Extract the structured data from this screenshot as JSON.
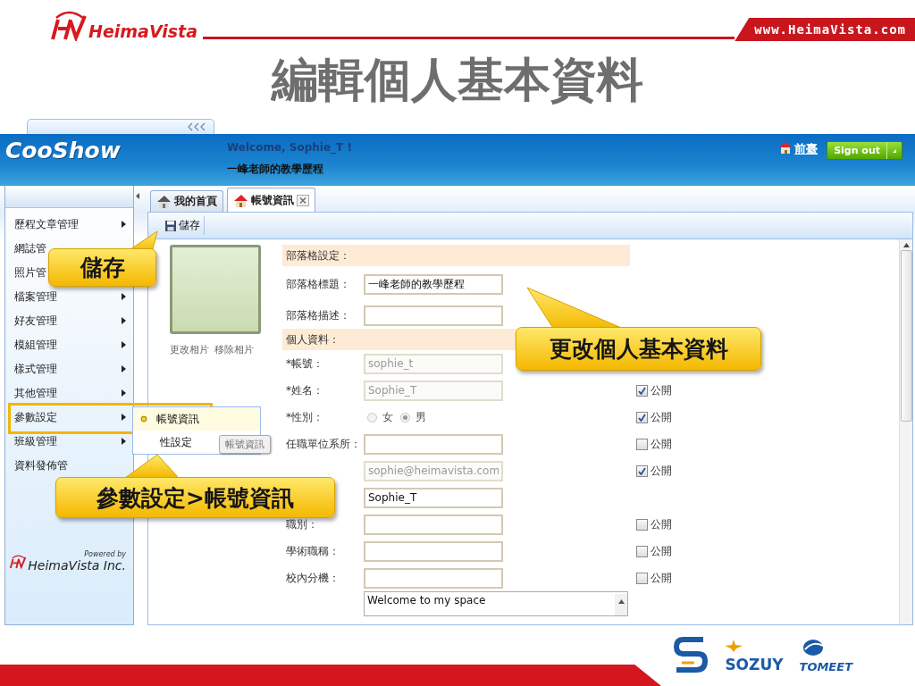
{
  "slide": {
    "brand": "HeimaVista",
    "url": "www.HeimaVista.com",
    "title": "編輯個人基本資料"
  },
  "app": {
    "logo": "CooShow",
    "welcome": "Welcome, Sophie_T !",
    "blog_name": "一峰老師的教學歷程",
    "front_link": "前臺",
    "sign_out": "Sign out"
  },
  "sidebar": {
    "items": [
      {
        "label": "歷程文章管理",
        "submenu": true
      },
      {
        "label": "網誌管",
        "submenu": false
      },
      {
        "label": "照片管",
        "submenu": false
      },
      {
        "label": "檔案管理",
        "submenu": true
      },
      {
        "label": "好友管理",
        "submenu": true
      },
      {
        "label": "模組管理",
        "submenu": true
      },
      {
        "label": "樣式管理",
        "submenu": true
      },
      {
        "label": "其他管理",
        "submenu": true
      },
      {
        "label": "參數設定",
        "submenu": true
      },
      {
        "label": "班級管理",
        "submenu": true
      },
      {
        "label": "資料發佈管",
        "submenu": false
      }
    ],
    "powered_by": "Powered by",
    "company": "HeimaVista Inc."
  },
  "tabs": [
    {
      "label": "我的首頁",
      "selected": false,
      "closable": false
    },
    {
      "label": "帳號資訊",
      "selected": true,
      "closable": true
    }
  ],
  "toolbar": {
    "save": "儲存"
  },
  "photo": {
    "actions": [
      "更改相片",
      "移除相片"
    ]
  },
  "form": {
    "rows": [
      {
        "kind": "section",
        "label": "部落格設定："
      },
      {
        "kind": "text",
        "label": "部落格標題：",
        "value": "一峰老師的教學歷程",
        "disabled": false
      },
      {
        "kind": "text",
        "label": "部落格描述：",
        "disabled": false
      },
      {
        "kind": "section",
        "label": "個人資料："
      },
      {
        "kind": "text",
        "label": "*帳號：",
        "value": "sophie_t",
        "disabled": true
      },
      {
        "kind": "text",
        "label": "*姓名：",
        "value": "Sophie_T",
        "disabled": true,
        "public": true,
        "public_label": "公開"
      },
      {
        "kind": "radio",
        "label": "*性別：",
        "disabled": true,
        "public": true,
        "public_label": "公開",
        "options": [
          {
            "label": "女",
            "selected": false
          },
          {
            "label": "男",
            "selected": true
          }
        ]
      },
      {
        "kind": "text",
        "label": "任職單位系所：",
        "disabled": false,
        "public": false,
        "public_label": "公開"
      },
      {
        "kind": "text",
        "value": "sophie@heimavista.com",
        "disabled": true,
        "public": true,
        "public_label": "公開"
      },
      {
        "kind": "text",
        "value": "Sophie_T",
        "disabled": false
      },
      {
        "kind": "text",
        "label": "職別：",
        "disabled": false,
        "public": false,
        "public_label": "公開"
      },
      {
        "kind": "text",
        "label": "學術職稱：",
        "disabled": false,
        "public": false,
        "public_label": "公開"
      },
      {
        "kind": "text",
        "label": "校內分機：",
        "disabled": false,
        "public": false,
        "public_label": "公開"
      },
      {
        "kind": "textarea",
        "value": "Welcome to my space"
      }
    ]
  },
  "submenu": {
    "items": [
      {
        "label": "帳號資訊",
        "selected": true
      },
      {
        "label": "性設定",
        "selected": false
      }
    ]
  },
  "tooltip": "帳號資訊",
  "callouts": [
    {
      "text": "儲存"
    },
    {
      "text": "更改個人基本資料"
    },
    {
      "text": "參數設定>帳號資訊"
    }
  ],
  "footer": {
    "logos": [
      "SOZUY",
      "TOMEET"
    ]
  }
}
